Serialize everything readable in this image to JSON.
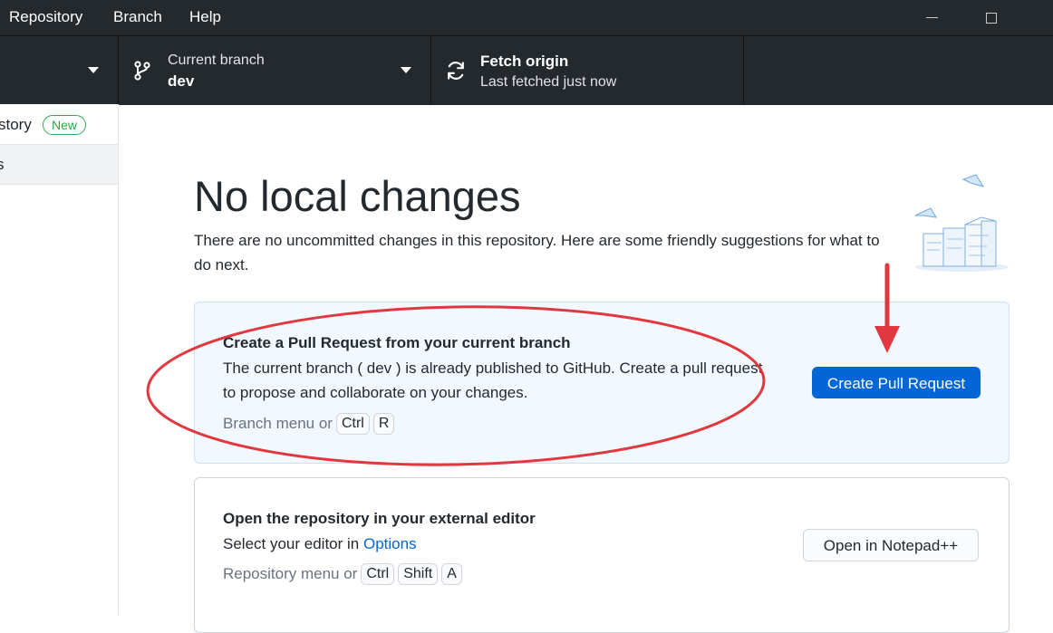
{
  "menubar": {
    "items": [
      "Repository",
      "Branch",
      "Help"
    ]
  },
  "toolbar": {
    "branch": {
      "title": "Current branch",
      "value": "dev"
    },
    "fetch": {
      "title": "Fetch origin",
      "subtitle": "Last fetched just now"
    }
  },
  "sidebar": {
    "history_label": "story",
    "new_badge": "New",
    "changes_label": "s"
  },
  "main": {
    "heading": "No local changes",
    "intro": "There are no uncommitted changes in this repository. Here are some friendly suggestions for what to do next.",
    "pull_request": {
      "title": "Create a Pull Request from your current branch",
      "description": "The current branch ( dev ) is already published to GitHub. Create a pull request to propose and collaborate on your changes.",
      "hint_text": "Branch menu or",
      "keys": [
        "Ctrl",
        "R"
      ],
      "button": "Create Pull Request"
    },
    "editor": {
      "title": "Open the repository in your external editor",
      "description_prefix": "Select your editor in",
      "options_link": "Options",
      "hint_text": "Repository menu or",
      "keys": [
        "Ctrl",
        "Shift",
        "A"
      ],
      "button": "Open in Notepad++"
    }
  },
  "colors": {
    "chrome": "#24292e",
    "accent": "#0366d6",
    "annotation": "#e0383e",
    "badge": "#28a745"
  }
}
